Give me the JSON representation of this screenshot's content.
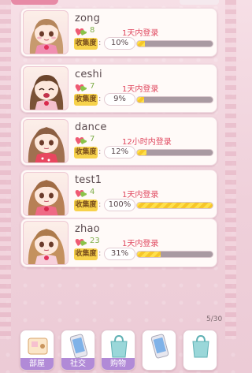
{
  "players": [
    {
      "name": "zong",
      "count": "8",
      "login": "1天内登录",
      "collect_label": "收集度",
      "percent_text": "10%",
      "progress": 0.1
    },
    {
      "name": "ceshi",
      "count": "7",
      "login": "1天内登录",
      "collect_label": "收集度",
      "percent_text": "9%",
      "progress": 0.09
    },
    {
      "name": "dance",
      "count": "7",
      "login": "12小时内登录",
      "collect_label": "收集度",
      "percent_text": "12%",
      "progress": 0.12
    },
    {
      "name": "test1",
      "count": "4",
      "login": "1天内登录",
      "collect_label": "收集度",
      "percent_text": "100%",
      "progress": 1.0
    },
    {
      "name": "zhao",
      "count": "23",
      "login": "1天内登录",
      "collect_label": "收集度",
      "percent_text": "31%",
      "progress": 0.31
    }
  ],
  "pagination": {
    "text": "5/30"
  },
  "nav": [
    {
      "label": "部屋",
      "icon": "room-icon"
    },
    {
      "label": "社交",
      "icon": "phone-icon"
    },
    {
      "label": "购物",
      "icon": "shopping-bag-icon"
    },
    {
      "label": "",
      "icon": "phone-icon"
    },
    {
      "label": "",
      "icon": "shopping-bag-icon"
    }
  ],
  "colors": {
    "login_text": "#e0485f",
    "count_text": "#7fae4a",
    "nav_label_bg": "#b18ad7",
    "bar_fill": "#ffe04a"
  }
}
